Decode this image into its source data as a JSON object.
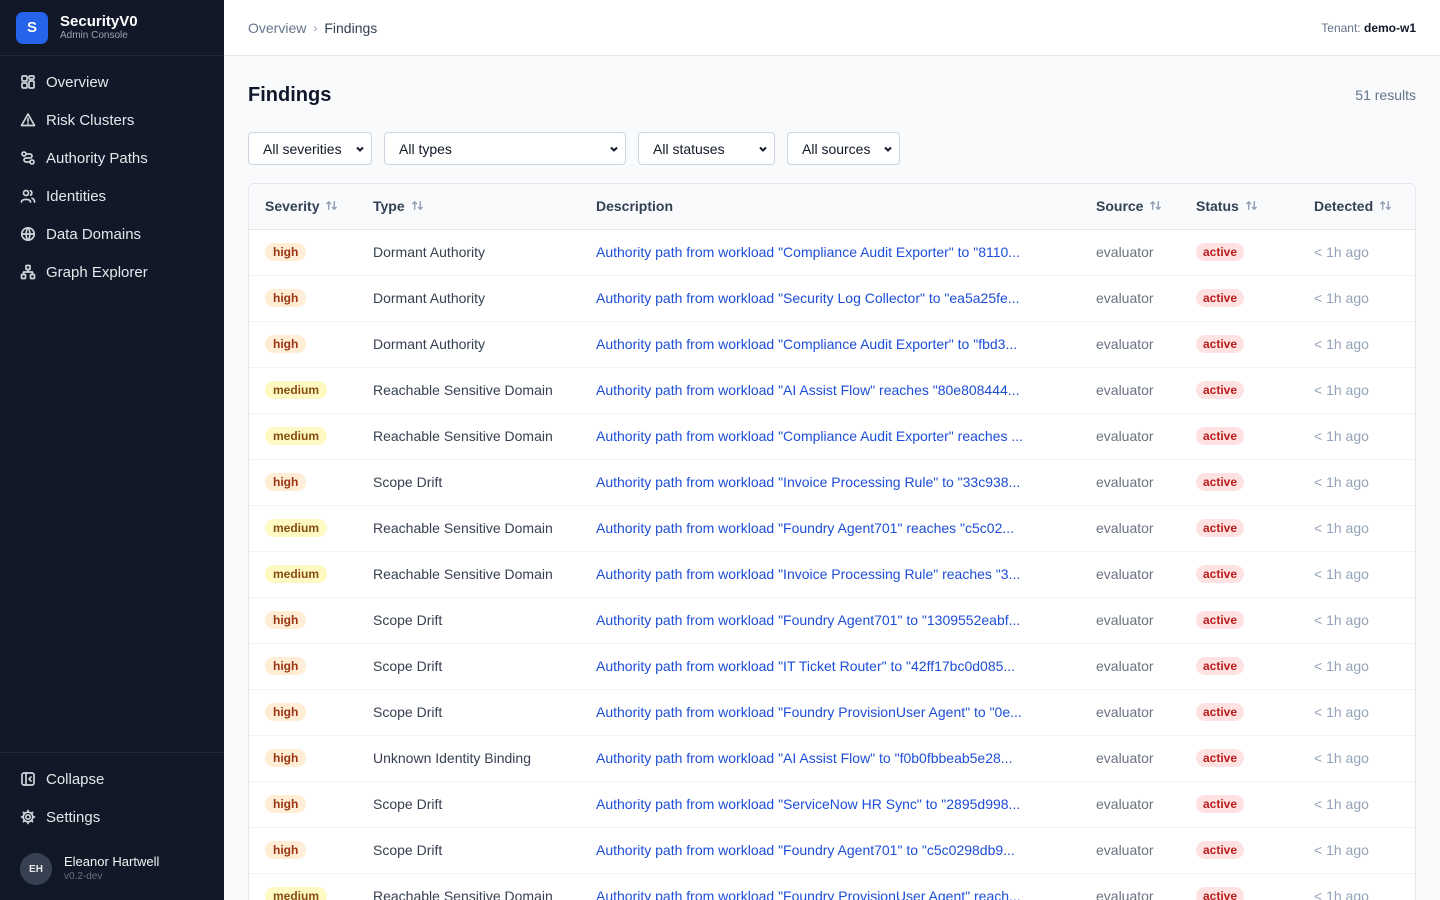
{
  "brand": {
    "logo_letter": "S",
    "name": "SecurityV0",
    "subtitle": "Admin Console"
  },
  "sidebar": {
    "items": [
      {
        "label": "Overview",
        "icon": "grid-icon"
      },
      {
        "label": "Risk Clusters",
        "icon": "warning-triangle-icon"
      },
      {
        "label": "Authority Paths",
        "icon": "route-icon"
      },
      {
        "label": "Identities",
        "icon": "users-icon"
      },
      {
        "label": "Data Domains",
        "icon": "globe-icon"
      },
      {
        "label": "Graph Explorer",
        "icon": "graph-icon"
      }
    ],
    "collapse_label": "Collapse",
    "settings_label": "Settings"
  },
  "user": {
    "initials": "EH",
    "name": "Eleanor Hartwell",
    "version": "v0.2-dev"
  },
  "header": {
    "breadcrumb": [
      "Overview",
      "Findings"
    ],
    "tenant_label": "Tenant:",
    "tenant_value": "demo-w1"
  },
  "page": {
    "title": "Findings",
    "results": "51 results"
  },
  "filters": {
    "severity": "All severities",
    "type": "All types",
    "status": "All statuses",
    "source": "All sources"
  },
  "table": {
    "columns": {
      "severity": "Severity",
      "type": "Type",
      "description": "Description",
      "source": "Source",
      "status": "Status",
      "detected": "Detected"
    },
    "rows": [
      {
        "severity": "high",
        "type": "Dormant Authority",
        "description": "Authority path from workload \"Compliance Audit Exporter\" to \"8110...",
        "source": "evaluator",
        "status": "active",
        "detected": "< 1h ago"
      },
      {
        "severity": "high",
        "type": "Dormant Authority",
        "description": "Authority path from workload \"Security Log Collector\" to \"ea5a25fe...",
        "source": "evaluator",
        "status": "active",
        "detected": "< 1h ago"
      },
      {
        "severity": "high",
        "type": "Dormant Authority",
        "description": "Authority path from workload \"Compliance Audit Exporter\" to \"fbd3...",
        "source": "evaluator",
        "status": "active",
        "detected": "< 1h ago"
      },
      {
        "severity": "medium",
        "type": "Reachable Sensitive Domain",
        "description": "Authority path from workload \"AI Assist Flow\" reaches \"80e808444...",
        "source": "evaluator",
        "status": "active",
        "detected": "< 1h ago"
      },
      {
        "severity": "medium",
        "type": "Reachable Sensitive Domain",
        "description": "Authority path from workload \"Compliance Audit Exporter\" reaches ...",
        "source": "evaluator",
        "status": "active",
        "detected": "< 1h ago"
      },
      {
        "severity": "high",
        "type": "Scope Drift",
        "description": "Authority path from workload \"Invoice Processing Rule\" to \"33c938...",
        "source": "evaluator",
        "status": "active",
        "detected": "< 1h ago"
      },
      {
        "severity": "medium",
        "type": "Reachable Sensitive Domain",
        "description": "Authority path from workload \"Foundry Agent701\" reaches \"c5c02...",
        "source": "evaluator",
        "status": "active",
        "detected": "< 1h ago"
      },
      {
        "severity": "medium",
        "type": "Reachable Sensitive Domain",
        "description": "Authority path from workload \"Invoice Processing Rule\" reaches \"3...",
        "source": "evaluator",
        "status": "active",
        "detected": "< 1h ago"
      },
      {
        "severity": "high",
        "type": "Scope Drift",
        "description": "Authority path from workload \"Foundry Agent701\" to \"1309552eabf...",
        "source": "evaluator",
        "status": "active",
        "detected": "< 1h ago"
      },
      {
        "severity": "high",
        "type": "Scope Drift",
        "description": "Authority path from workload \"IT Ticket Router\" to \"42ff17bc0d085...",
        "source": "evaluator",
        "status": "active",
        "detected": "< 1h ago"
      },
      {
        "severity": "high",
        "type": "Scope Drift",
        "description": "Authority path from workload \"Foundry ProvisionUser Agent\" to \"0e...",
        "source": "evaluator",
        "status": "active",
        "detected": "< 1h ago"
      },
      {
        "severity": "high",
        "type": "Unknown Identity Binding",
        "description": "Authority path from workload \"AI Assist Flow\" to \"f0b0fbbeab5e28...",
        "source": "evaluator",
        "status": "active",
        "detected": "< 1h ago"
      },
      {
        "severity": "high",
        "type": "Scope Drift",
        "description": "Authority path from workload \"ServiceNow HR Sync\" to \"2895d998...",
        "source": "evaluator",
        "status": "active",
        "detected": "< 1h ago"
      },
      {
        "severity": "high",
        "type": "Scope Drift",
        "description": "Authority path from workload \"Foundry Agent701\" to \"c5c0298db9...",
        "source": "evaluator",
        "status": "active",
        "detected": "< 1h ago"
      },
      {
        "severity": "medium",
        "type": "Reachable Sensitive Domain",
        "description": "Authority path from workload \"Foundry ProvisionUser Agent\" reach...",
        "source": "evaluator",
        "status": "active",
        "detected": "< 1h ago"
      }
    ]
  },
  "colors": {
    "sidebar_bg": "#111827",
    "brand_accent": "#2563eb",
    "link": "#1d4ed8",
    "badge_high": "#ffedd5",
    "badge_medium": "#fef9c3",
    "badge_active": "#fee2e2"
  }
}
